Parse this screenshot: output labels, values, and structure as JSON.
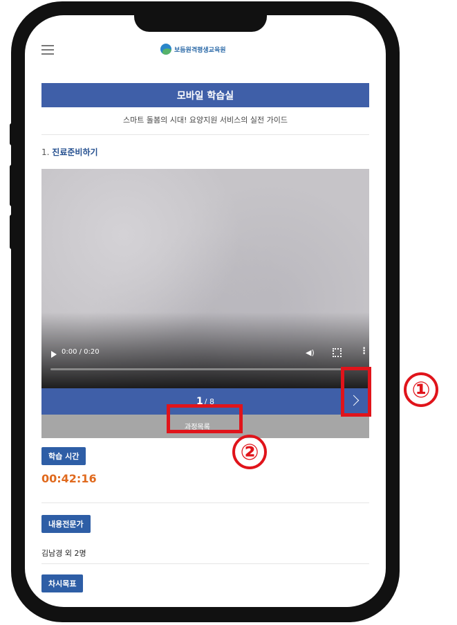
{
  "header": {
    "logo_text": "보듬원격평생교육원",
    "page_title": "모바일 학습실"
  },
  "course": {
    "subtitle": "스마트 돌봄의 시대! 요양지원 서비스의 실전 가이드",
    "lesson_number": "1.",
    "lesson_title": "진료준비하기"
  },
  "video": {
    "time": "0:00 / 0:20",
    "progress": 0.0
  },
  "pager": {
    "current": "1",
    "total": "/ 8",
    "course_list_label": "과정목록"
  },
  "study_time": {
    "label": "학습 시간",
    "value": "00:42:16"
  },
  "expert": {
    "label": "내용전문가",
    "value": "김남경 외 2명"
  },
  "objective": {
    "label": "차시목표"
  },
  "annotations": {
    "one": "①",
    "two": "②",
    "color": "#e0141b"
  },
  "icons": [
    "menu-icon",
    "play-icon",
    "volume-icon",
    "fullscreen-icon",
    "more-icon",
    "chevron-right-icon"
  ]
}
